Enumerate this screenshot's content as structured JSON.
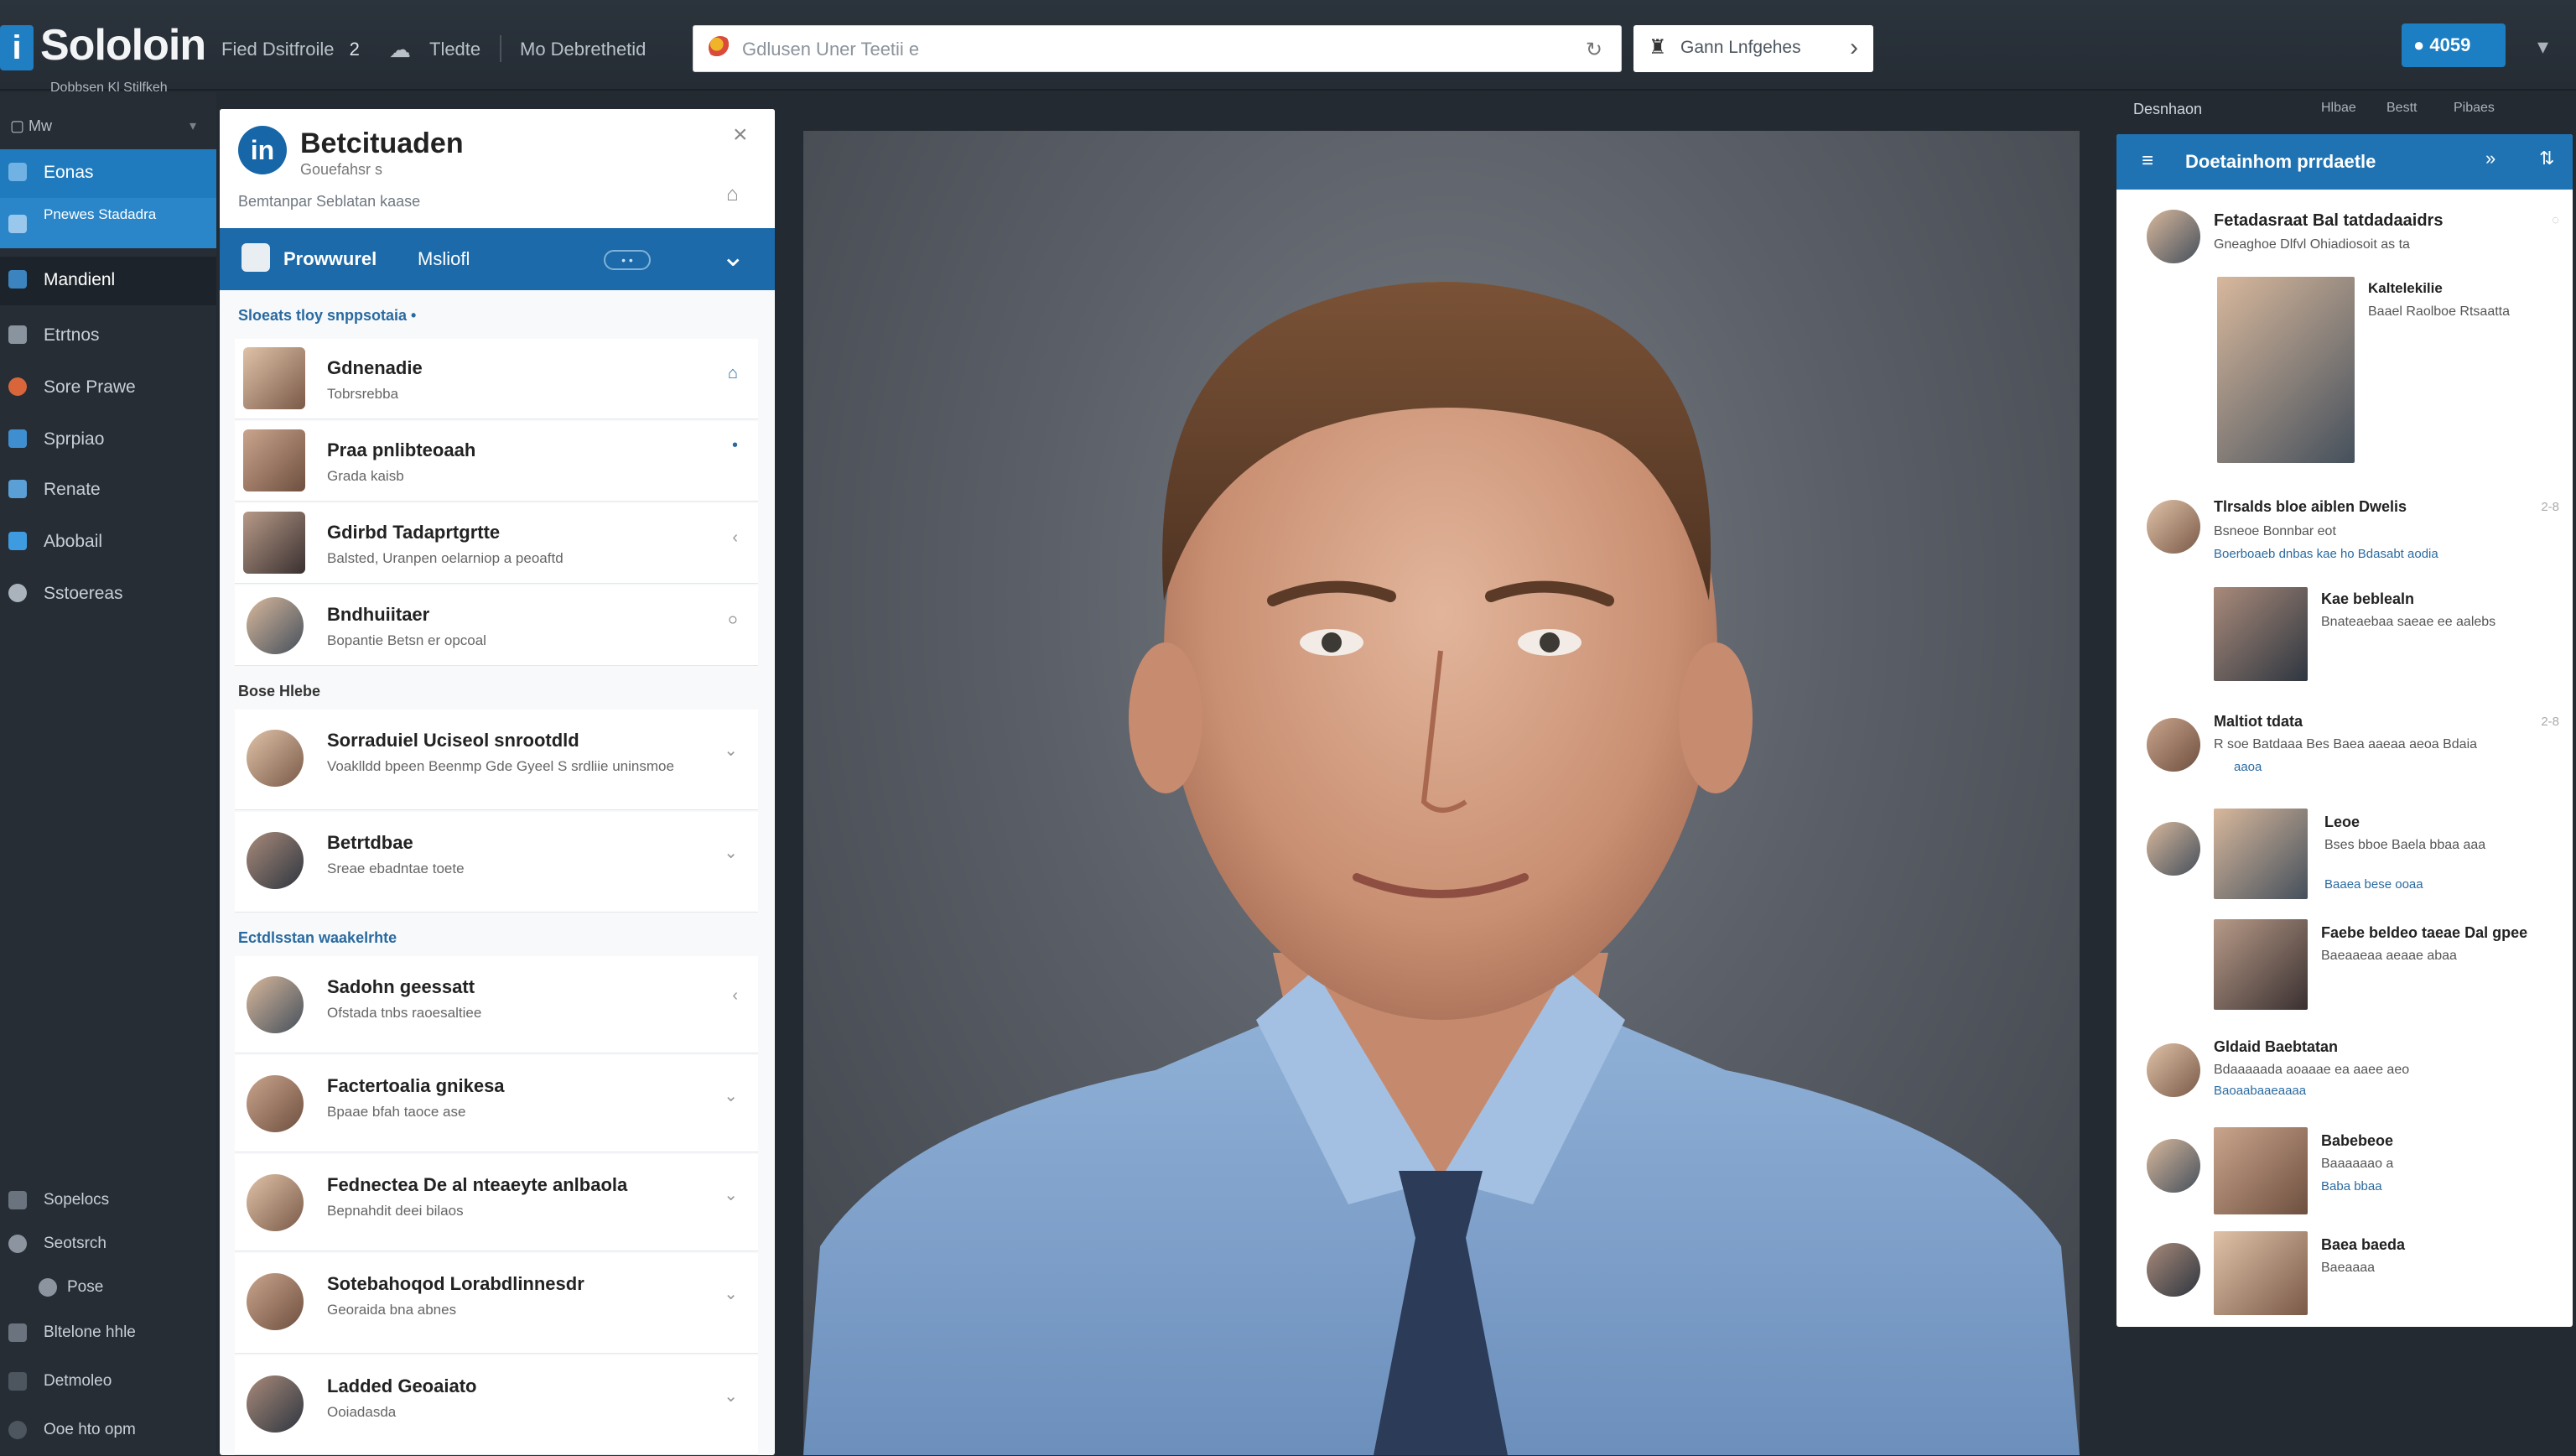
{
  "app": {
    "logo_mark": "i",
    "title": "Sololoin",
    "subtitle": "Dobbsen Kl Stilfkeh"
  },
  "topnav": {
    "item1": "Fied Dsitfroile",
    "item1_badge": "2",
    "item2": "Tledte",
    "item3": "Mo Debrethetid"
  },
  "search": {
    "placeholder": "Gdlusen Uner Teetii e",
    "icon_right": "↻"
  },
  "company": {
    "label": "Gann Lnfgehes",
    "chevron": "›"
  },
  "account": {
    "label": "● 4059",
    "chevron": "▾"
  },
  "sidebar": {
    "header": "Mw",
    "items": [
      {
        "label": "Eonas",
        "active": true
      },
      {
        "label": "Pnewes Stadadra",
        "active": true
      },
      {
        "label": "Mandienl",
        "active": false
      },
      {
        "label": "Etrtnos",
        "active": false
      },
      {
        "label": "Sore Prawe",
        "active": false
      },
      {
        "label": "Sprpiao",
        "active": false
      },
      {
        "label": "Renate",
        "active": false
      },
      {
        "label": "Abobail",
        "active": false
      },
      {
        "label": "Sstoereas",
        "active": false
      }
    ],
    "bottom_items": [
      {
        "label": "Sopelocs"
      },
      {
        "label": "Seotsrch"
      },
      {
        "label": "Pose"
      },
      {
        "label": "Bltelone hhle"
      },
      {
        "label": "Detmoleo"
      },
      {
        "label": "Ooe hto opm"
      }
    ]
  },
  "left_panel": {
    "badge": "in",
    "title": "Betcituaden",
    "subtitle": "Gouefahsr s",
    "subtitle2": "Bemtanpar Seblatan kaase",
    "close": "×",
    "bell": "⌂",
    "tab_primary": "Prowwurel",
    "tab_secondary": "Msliofl",
    "tab_pill": "• •",
    "tab_chevron": "⌄",
    "section1": "Sloeats tloy snppsotaia •",
    "section2": "Bose Hlebe",
    "section3": "Ectdlsstan waakelrhte",
    "conversations": [
      {
        "name": "Gdnenadie",
        "snippet": "Tobrsrebba",
        "meta": "⌂"
      },
      {
        "name": "Praa pnlibteoaah",
        "snippet": "Grada kaisb",
        "meta": "•"
      },
      {
        "name": "Gdirbd Tadaprtgrtte",
        "snippet": "Balsted, Uranpen oelarniop a peoaftd",
        "meta": "‹"
      },
      {
        "name": "Bndhuiitaer",
        "snippet": "Bopantie Betsn er opcoal",
        "meta": "○"
      },
      {
        "name": "Sorraduiel Uciseol snrootdld",
        "snippet": "Voaklldd bpeen Beenmp Gde Gyeel S srdliie uninsmoe",
        "meta": "⌄"
      },
      {
        "name": "Betrtdbae",
        "snippet": "Sreae ebadntae toete",
        "meta": "⌄"
      },
      {
        "name": "Sadohn geessatt",
        "snippet": "Ofstada tnbs raoesaltiee",
        "meta": "‹"
      },
      {
        "name": "Factertoalia gnikesa",
        "snippet": "Bpaae bfah taoce ase",
        "meta": "⌄"
      },
      {
        "name": "Fednectea De al nteaeyte anlbaola",
        "snippet": "Bepnahdit deei bilaos",
        "meta": "⌄"
      },
      {
        "name": "Sotebahoqod Lorabdlinnesdr",
        "snippet": "Georaida bna abnes",
        "meta": "⌄"
      },
      {
        "name": "Ladded Geoaiato",
        "snippet": "Ooiadasda",
        "meta": "⌄"
      }
    ]
  },
  "right_bar": {
    "title": "Desnhaon",
    "t2": "Hlbae",
    "t3": "Bestt",
    "t4": "Pibaes"
  },
  "right_panel": {
    "header": "Doetainhom prrdaetle",
    "feed": [
      {
        "name": "Fetadasraat Bal tatdadaaidrs",
        "text": "Gneaghoe Dlfvl Ohiadiosoit as ta",
        "time": "◌"
      },
      {
        "name": "Kaltelekilie",
        "text": "Baael Raolboe Rtsaatta",
        "time": ""
      },
      {
        "name": "Tlrsalds bloe aiblen Dwelis",
        "text": "Bsneoe Bonnbar eot",
        "link": "Boerboaeb dnbas kae ho Bdasabt aodia",
        "time": "2-8"
      },
      {
        "name": "Kae beblealn",
        "text": "Bnateaebaa saeae ee aalebs",
        "time": ""
      },
      {
        "name": "Maltiot tdata",
        "text": "R soe Batdaaa Bes Baea aaeaa aeoa Bdaia",
        "link": "aaoa",
        "time": "2-8"
      },
      {
        "name": "Leoe",
        "text": "Bses bboe Baela bbaa aaa",
        "link": "Baaea bese ooaa",
        "time": ""
      },
      {
        "name": "Faebe beldeo taeae Dal gpee",
        "text": "Baeaaeaa aeaae abaa",
        "time": ""
      },
      {
        "name": "Gldaid Baebtatan",
        "text": "Bdaaaaada aoaaae ea aaee aeo",
        "link": "Baoaabaaeaaaa",
        "time": ""
      },
      {
        "name": "Babebeoe",
        "text": "Baaaaaao a",
        "link": "Baba bbaa",
        "time": ""
      },
      {
        "name": "Baea baeda",
        "text": "Baeaaaa",
        "time": ""
      }
    ]
  }
}
